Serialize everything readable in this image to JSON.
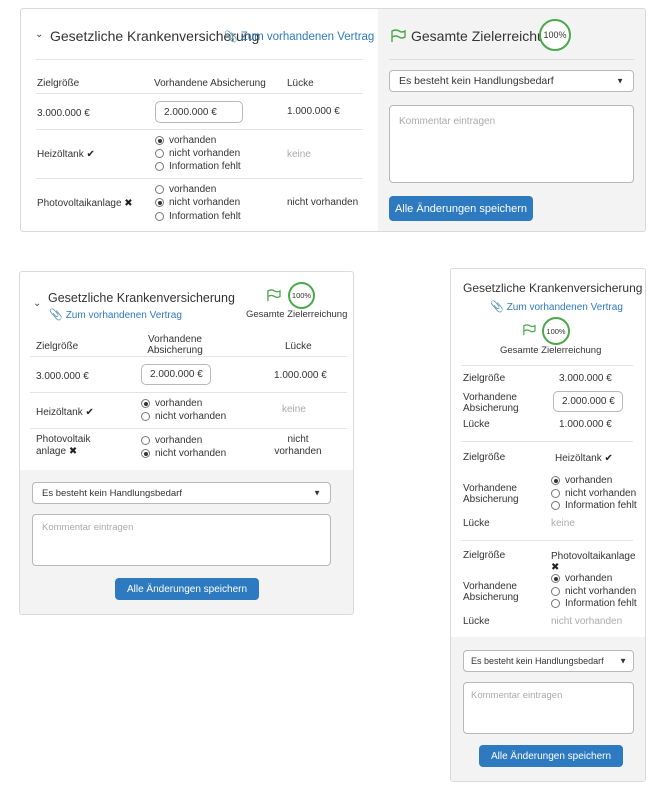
{
  "card_title": "Gesetzliche Krankenversicherung",
  "contract_link": "Zum vorhandenen Vertrag",
  "goal_label_wide": "Gesamte Zielerreichung:",
  "goal_label": "Gesamte Zielerreichung",
  "goal_percent": "100%",
  "columns": {
    "target": "Zielgröße",
    "coverage": "Vorhandene Absicherung",
    "gap": "Lücke"
  },
  "rows": {
    "main": {
      "target": "3.000.000 €",
      "coverage_value": "2.000.000 €",
      "gap": "1.000.000 €"
    },
    "heating": {
      "name": "Heizöltank",
      "gap": "keine",
      "status_icon": "check-icon"
    },
    "pv": {
      "name": "Photovoltaikanlage",
      "name_wrap_1": "Photovoltaik",
      "name_wrap_2": "anlage",
      "gap": "nicht vorhanden",
      "gap_wrap_1": "nicht",
      "gap_wrap_2": "vorhanden",
      "status_icon": "cross-icon"
    }
  },
  "radio_options": {
    "present": "vorhanden",
    "absent": "nicht vorhanden",
    "missing": "Information fehlt"
  },
  "action_select": "Es besteht kein Handlungsbedarf",
  "comment_placeholder": "Kommentar eintragen",
  "save_button": "Alle Änderungen speichern",
  "colors": {
    "accent": "#2d7ac0",
    "success": "#4aa84a",
    "panel_bg": "#f3f3f3"
  }
}
